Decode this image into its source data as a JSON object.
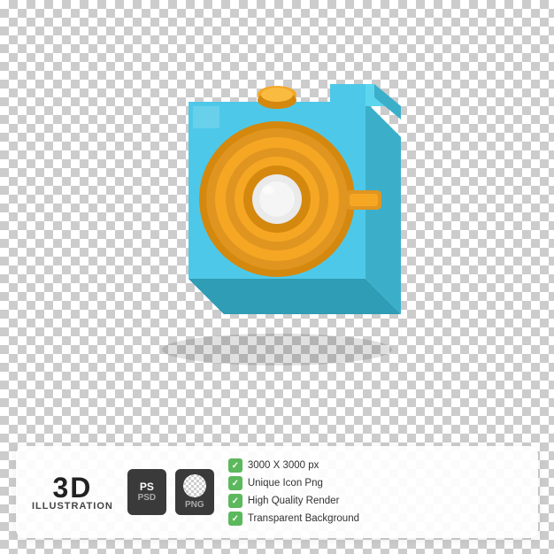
{
  "background": {
    "type": "checkered"
  },
  "camera": {
    "body_color": "#4FC3E0",
    "body_dark_color": "#3AAFC8",
    "button_color": "#F5A623",
    "lens_outer_color": "#F5A623",
    "lens_inner_color": "#FFFFFF",
    "lens_ring_color": "#E09520",
    "body_side_color": "#2E9DB5",
    "viewfinder_color": "#F5A623"
  },
  "info_card": {
    "label_3d": "3D",
    "label_illustration": "ILLUSTRATION",
    "file_types": [
      {
        "top": "PS",
        "bottom": "PSD",
        "type": "ps"
      },
      {
        "top": "",
        "bottom": "PNG",
        "type": "png"
      }
    ],
    "features": [
      "3000 X 3000 px",
      "Unique Icon Png",
      "High Quality Render",
      "Transparent Background"
    ]
  }
}
